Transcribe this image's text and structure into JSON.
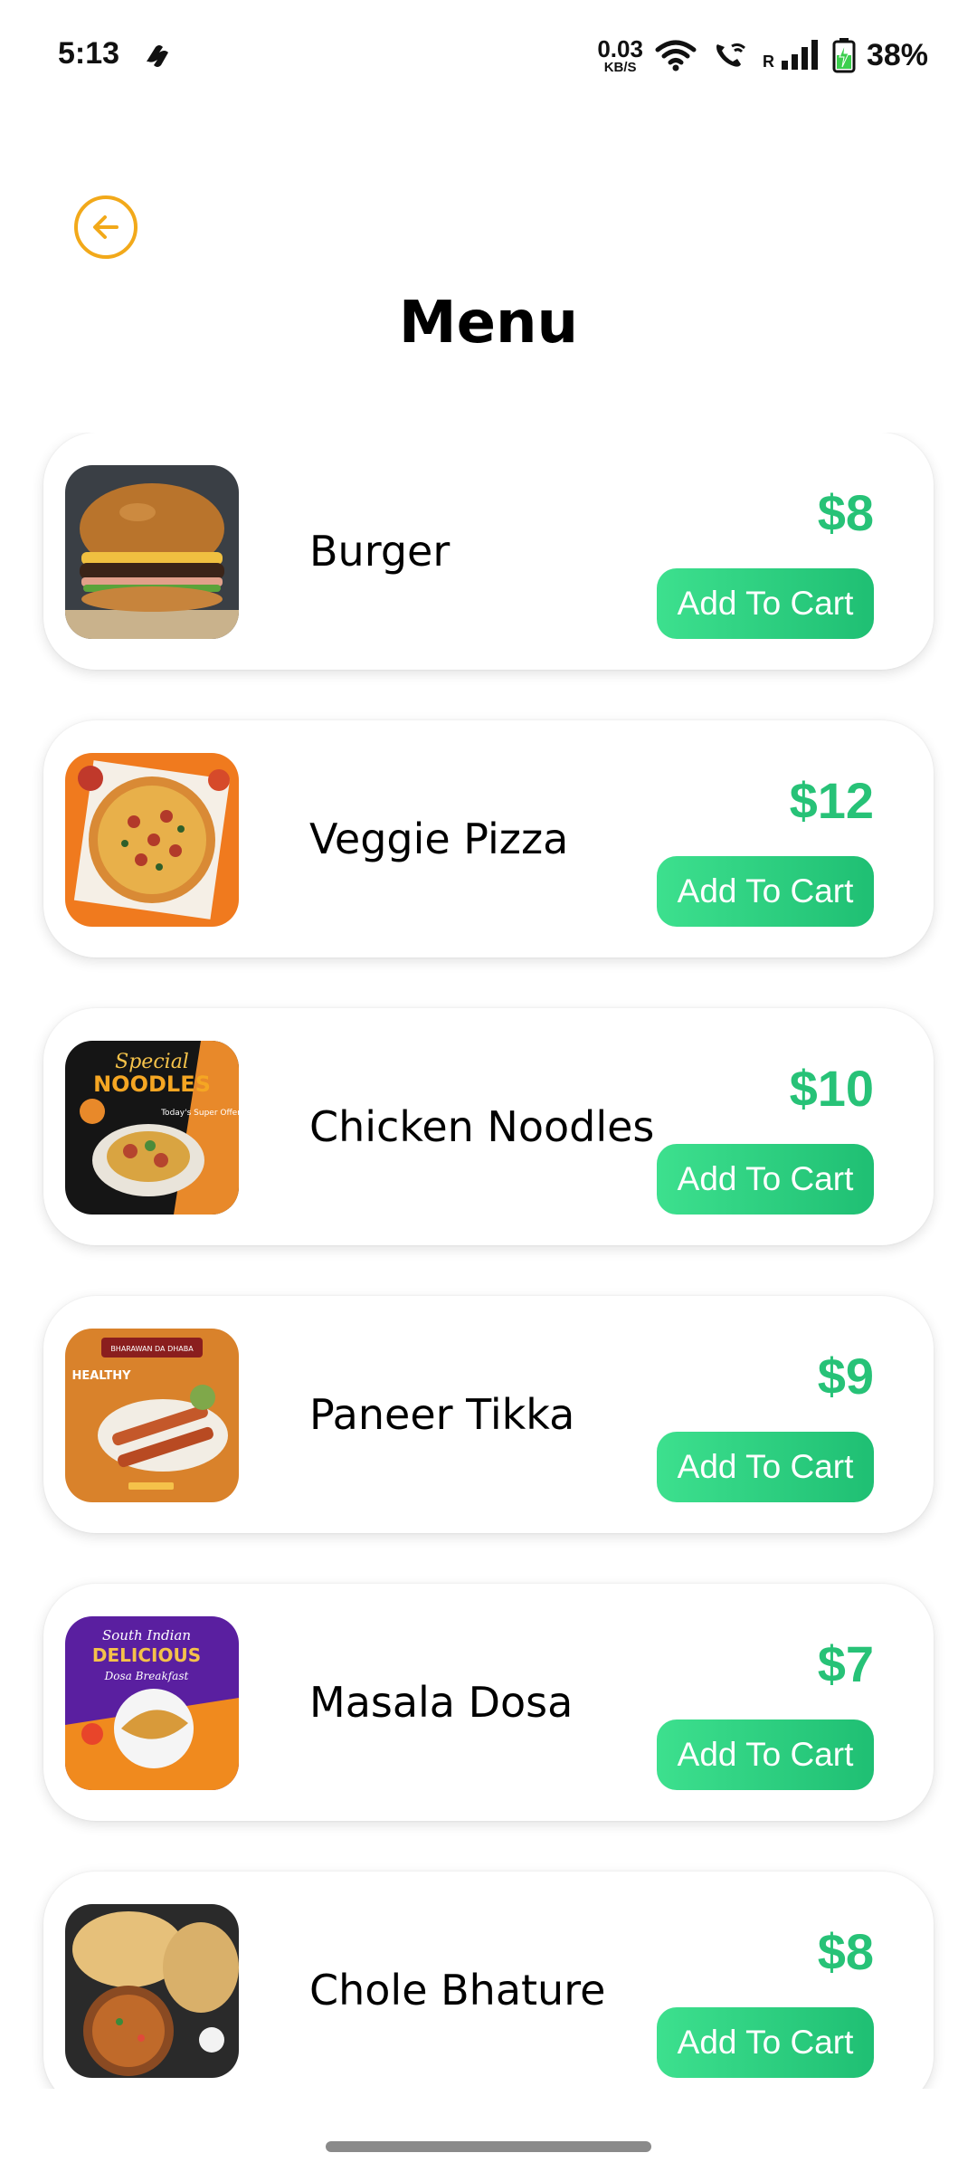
{
  "status_bar": {
    "time": "5:13",
    "net_speed_value": "0.03",
    "net_speed_unit": "KB/S",
    "network_type": "R",
    "battery": "38%"
  },
  "header": {
    "title": "Menu",
    "back_icon": "arrow-left-circle-icon"
  },
  "colors": {
    "accent_orange": "#f2a91a",
    "price_green": "#27c277",
    "button_green_start": "#3de08e",
    "button_green_end": "#1fbf73"
  },
  "items": [
    {
      "name": "Burger",
      "price": "$8",
      "button": "Add To Cart",
      "image": "burger-photo"
    },
    {
      "name": "Veggie Pizza",
      "price": "$12",
      "button": "Add To Cart",
      "image": "pizza-photo"
    },
    {
      "name": "Chicken Noodles",
      "price": "$10",
      "button": "Add To Cart",
      "image": "noodles-poster",
      "image_text": [
        "Special",
        "NOODLES",
        "Today's Super Offer"
      ]
    },
    {
      "name": "Paneer Tikka",
      "price": "$9",
      "button": "Add To Cart",
      "image": "paneer-tikka-poster",
      "image_text": [
        "BHARAWAN DA DHABA",
        "HEALTHY"
      ]
    },
    {
      "name": "Masala Dosa",
      "price": "$7",
      "button": "Add To Cart",
      "image": "dosa-poster",
      "image_text": [
        "South Indian",
        "DELICIOUS",
        "Dosa Breakfast"
      ]
    },
    {
      "name": "Chole Bhature",
      "price": "$8",
      "button": "Add To Cart",
      "image": "chole-bhature-photo"
    }
  ]
}
